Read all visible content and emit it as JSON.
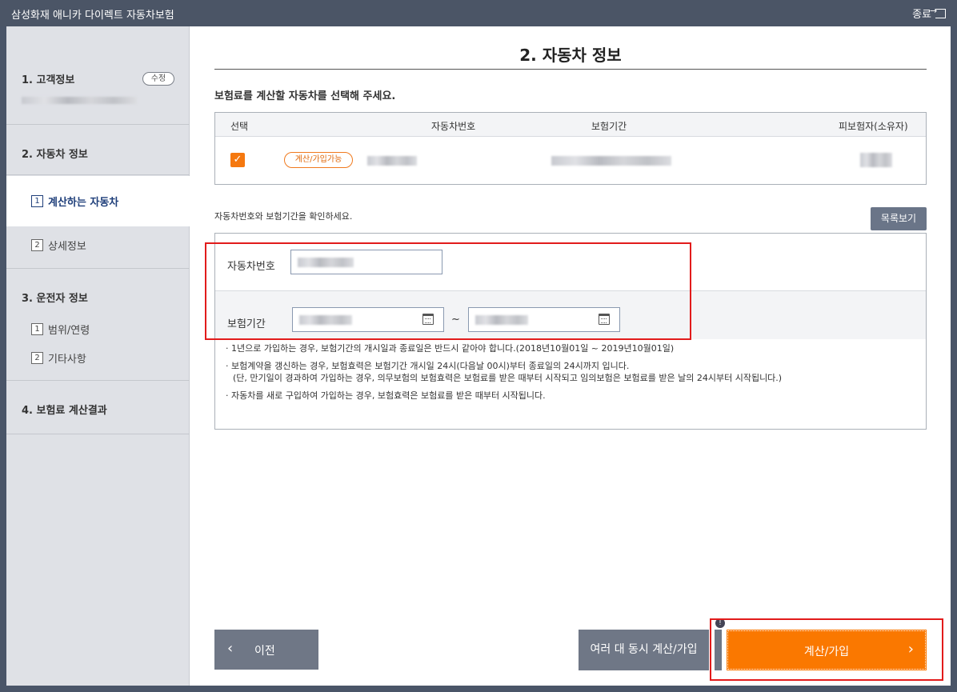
{
  "window": {
    "title": "삼성화재 애니카 다이렉트 자동차보험",
    "close_label": "종료"
  },
  "sidebar": {
    "step1": {
      "label": "1. 고객정보",
      "edit_label": "수정"
    },
    "step2": {
      "label": "2. 자동차 정보",
      "subs": [
        {
          "num": "1",
          "label": "계산하는 자동차",
          "active": true
        },
        {
          "num": "2",
          "label": "상세정보",
          "active": false
        }
      ]
    },
    "step3": {
      "label": "3. 운전자 정보",
      "subs": [
        {
          "num": "1",
          "label": "범위/연령"
        },
        {
          "num": "2",
          "label": "기타사항"
        }
      ]
    },
    "step4": {
      "label": "4. 보험료 계산결과"
    }
  },
  "main": {
    "title": "2. 자동차 정보",
    "instruction": "보험료를 계산할 자동차를 선택해 주세요.",
    "table": {
      "headers": [
        "선택",
        "자동차번호",
        "보험기간",
        "피보험자(소유자)"
      ],
      "row": {
        "checked": true,
        "badge": "계산/가입가능"
      }
    },
    "confirm_text": "자동차번호와 보험기간을 확인하세요.",
    "list_button": "목록보기",
    "form": {
      "car_number_label": "자동차번호",
      "period_label": "보험기간",
      "tilde": "~"
    },
    "notes": [
      "· 1년으로 가입하는 경우, 보험기간의 개시일과 종료일은 반드시 같아야 합니다.(2018년10월01일 ~ 2019년10월01일)",
      "· 보험계약을 갱신하는 경우, 보험효력은 보험기간 개시일 24시(다음날 00시)부터 종료일의 24시까지 입니다.",
      "(단, 만기일이 경과하여 가입하는 경우, 의무보험의 보험효력은 보험료를 받은 때부터 시작되고 임의보험은 보험료를 받은 날의 24시부터 시작됩니다.)",
      "· 자동차를 새로 구입하여 가입하는 경우, 보험효력은 보험료를 받은 때부터 시작됩니다."
    ]
  },
  "footer": {
    "prev_label": "이전",
    "multi_label": "여러 대 동시 계산/가입",
    "calc_label": "계산/가입"
  },
  "colors": {
    "accent": "#fa7800",
    "highlight_border": "#e21b1b",
    "nav_active": "#1f3f7a"
  }
}
